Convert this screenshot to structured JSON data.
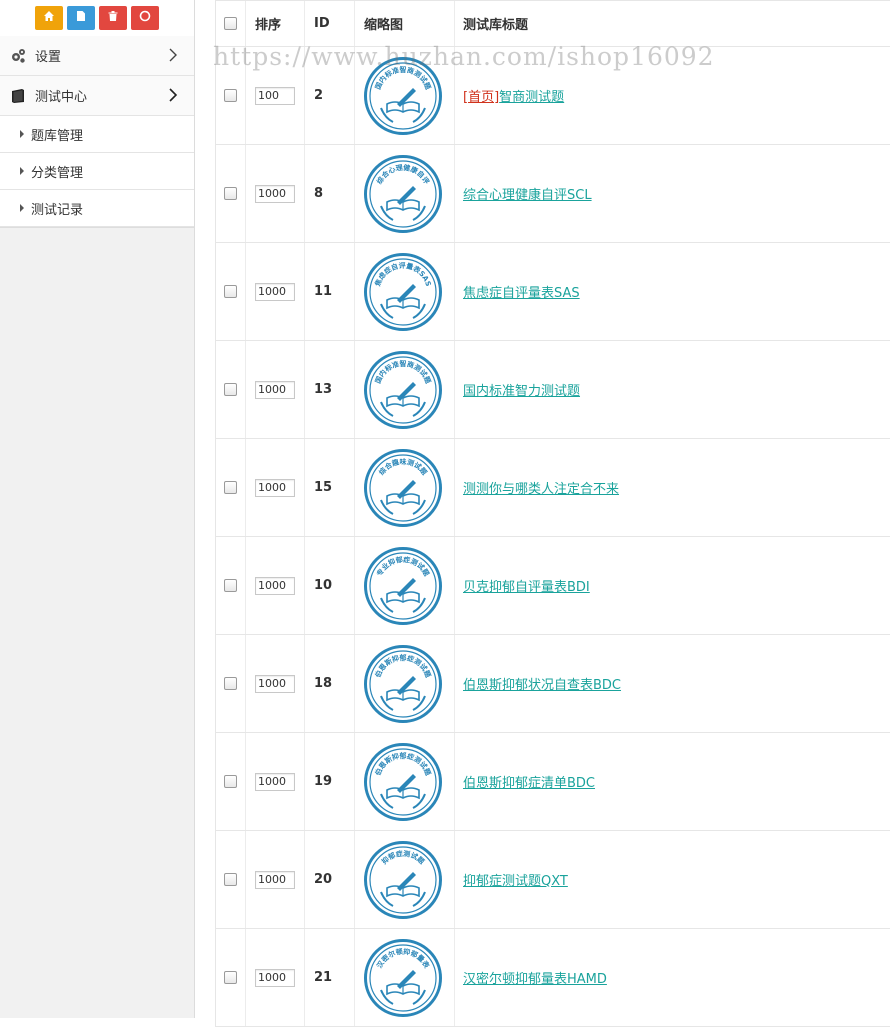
{
  "toolbar": {
    "buttons": [
      {
        "name": "home-button",
        "icon": "home-icon",
        "color": "#f0a30a"
      },
      {
        "name": "file-button",
        "icon": "file-icon",
        "color": "#3a9ad9"
      },
      {
        "name": "delete-button",
        "icon": "trash-icon",
        "color": "#e2473f"
      },
      {
        "name": "recycle-button",
        "icon": "recycle-icon",
        "color": "#e2473f"
      }
    ]
  },
  "sidebar": {
    "groups": [
      {
        "label": "设置",
        "icon": "gears-icon",
        "expanded": false
      },
      {
        "label": "测试中心",
        "icon": "book-icon",
        "expanded": true
      }
    ],
    "subitems": [
      {
        "label": "题库管理"
      },
      {
        "label": "分类管理"
      },
      {
        "label": "测试记录"
      }
    ]
  },
  "table": {
    "headers": {
      "sort": "排序",
      "id": "ID",
      "thumb": "缩略图",
      "title": "测试库标题"
    },
    "rows": [
      {
        "sort": "100",
        "id": "2",
        "prefix": "[首页]",
        "title": "智商测试题",
        "badge": "国内标准智商测试题"
      },
      {
        "sort": "1000",
        "id": "8",
        "prefix": "",
        "title": "综合心理健康自评SCL",
        "badge": "综合心理健康自评"
      },
      {
        "sort": "1000",
        "id": "11",
        "prefix": "",
        "title": "焦虑症自评量表SAS",
        "badge": "焦虑症自评量表SAS"
      },
      {
        "sort": "1000",
        "id": "13",
        "prefix": "",
        "title": "国内标准智力测试题",
        "badge": "国内标准智商测试题"
      },
      {
        "sort": "1000",
        "id": "15",
        "prefix": "",
        "title": "测测你与哪类人注定合不来",
        "badge": "综合趣味测试题"
      },
      {
        "sort": "1000",
        "id": "10",
        "prefix": "",
        "title": "贝克抑郁自评量表BDI",
        "badge": "专业抑郁症测试题"
      },
      {
        "sort": "1000",
        "id": "18",
        "prefix": "",
        "title": "伯恩斯抑郁状况自查表BDC",
        "badge": "伯恩斯抑郁症测试题"
      },
      {
        "sort": "1000",
        "id": "19",
        "prefix": "",
        "title": "伯恩斯抑郁症清单BDC",
        "badge": "伯恩斯抑郁症测试题"
      },
      {
        "sort": "1000",
        "id": "20",
        "prefix": "",
        "title": "抑郁症测试题QXT",
        "badge": "抑郁症测试题"
      },
      {
        "sort": "1000",
        "id": "21",
        "prefix": "",
        "title": "汉密尔顿抑郁量表HAMD",
        "badge": "汉密尔顿抑郁量表"
      }
    ]
  },
  "watermark": "https://www.huzhan.com/ishop16092",
  "colors": {
    "link": "#1aa39c",
    "prefix": "#d0321c",
    "badge": "#2a86b8"
  }
}
